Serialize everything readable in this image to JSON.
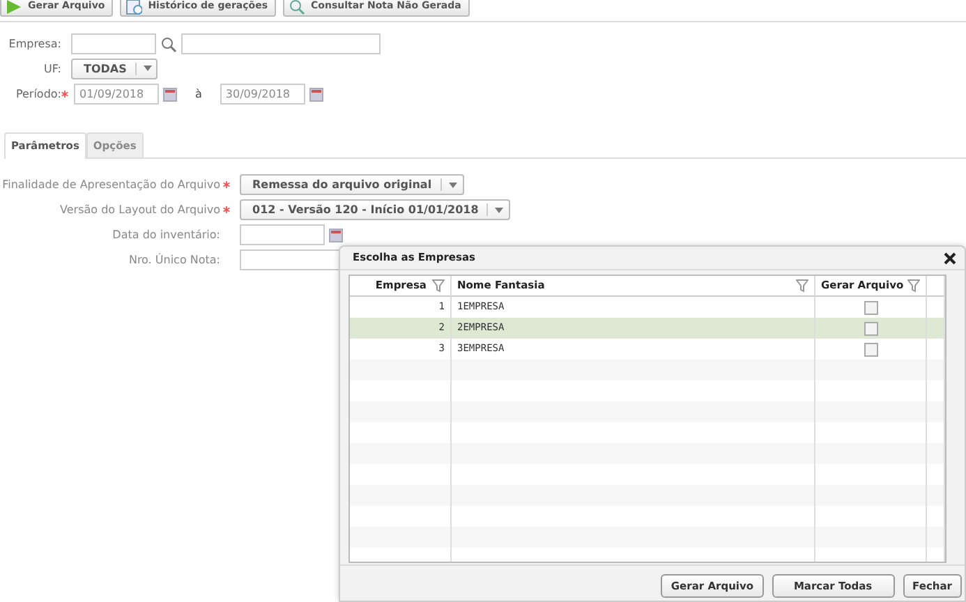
{
  "toolbar": [
    {
      "label": "Gerar Arquivo"
    },
    {
      "label": "Histórico de gerações"
    },
    {
      "label": "Consultar Nota Não Gerada"
    }
  ],
  "filters": {
    "empresa": {
      "label": "Empresa:"
    },
    "uf": {
      "label": "UF:",
      "value": "TODAS"
    },
    "periodo": {
      "label": "Período:",
      "required": true,
      "from": "01/09/2018",
      "separator": "à",
      "to": "30/09/2018"
    }
  },
  "tabs": [
    {
      "label": "Parâmetros",
      "selected": true
    },
    {
      "label": "Opções",
      "selected": false
    }
  ],
  "parameters": [
    {
      "kind": "select",
      "label": "Finalidade de Apresentação do Arquivo",
      "required": true,
      "value": "Remessa do arquivo original"
    },
    {
      "kind": "select",
      "label": "Versão do Layout do Arquivo",
      "required": true,
      "value": "012 - Versão 120 - Início 01/01/2018"
    },
    {
      "kind": "date",
      "label": "Data do inventário:",
      "required": false
    },
    {
      "kind": "text",
      "label": "Nro. Único Nota:",
      "required": false
    }
  ],
  "dialog": {
    "title": "Escolha as Empresas",
    "columns": [
      "Empresa",
      "Nome Fantasia",
      "Gerar Arquivo"
    ],
    "rows": [
      {
        "code": "1",
        "name": "1EMPRESA",
        "checked": false,
        "selected": false
      },
      {
        "code": "2",
        "name": "2EMPRESA",
        "checked": false,
        "selected": true
      },
      {
        "code": "3",
        "name": "3EMPRESA",
        "checked": false,
        "selected": false
      }
    ],
    "buttons": [
      "Gerar Arquivo",
      "Marcar Todas",
      "Fechar"
    ]
  }
}
